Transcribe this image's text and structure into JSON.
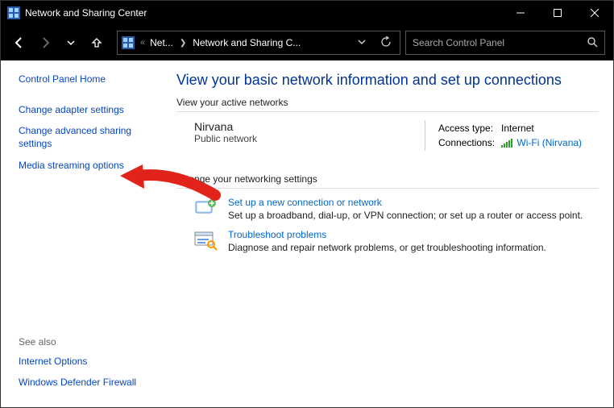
{
  "window": {
    "title": "Network and Sharing Center"
  },
  "breadcrumb": {
    "sep_prefix": "«",
    "item1": "Net...",
    "item2": "Network and Sharing C..."
  },
  "search": {
    "placeholder": "Search Control Panel"
  },
  "sidebar": {
    "home": "Control Panel Home",
    "adapter": "Change adapter settings",
    "advanced": "Change advanced sharing settings",
    "media": "Media streaming options",
    "see_also_label": "See also",
    "internet_options": "Internet Options",
    "firewall": "Windows Defender Firewall"
  },
  "main": {
    "heading": "View your basic network information and set up connections",
    "active_label": "View your active networks",
    "net_name": "Nirvana",
    "net_type": "Public network",
    "access_label": "Access type:",
    "access_value": "Internet",
    "conn_label": "Connections:",
    "conn_value": "Wi-Fi (Nirvana)",
    "change_label": "Change your networking settings",
    "opt1_title": "Set up a new connection or network",
    "opt1_desc": "Set up a broadband, dial-up, or VPN connection; or set up a router or access point.",
    "opt2_title": "Troubleshoot problems",
    "opt2_desc": "Diagnose and repair network problems, or get troubleshooting information."
  }
}
